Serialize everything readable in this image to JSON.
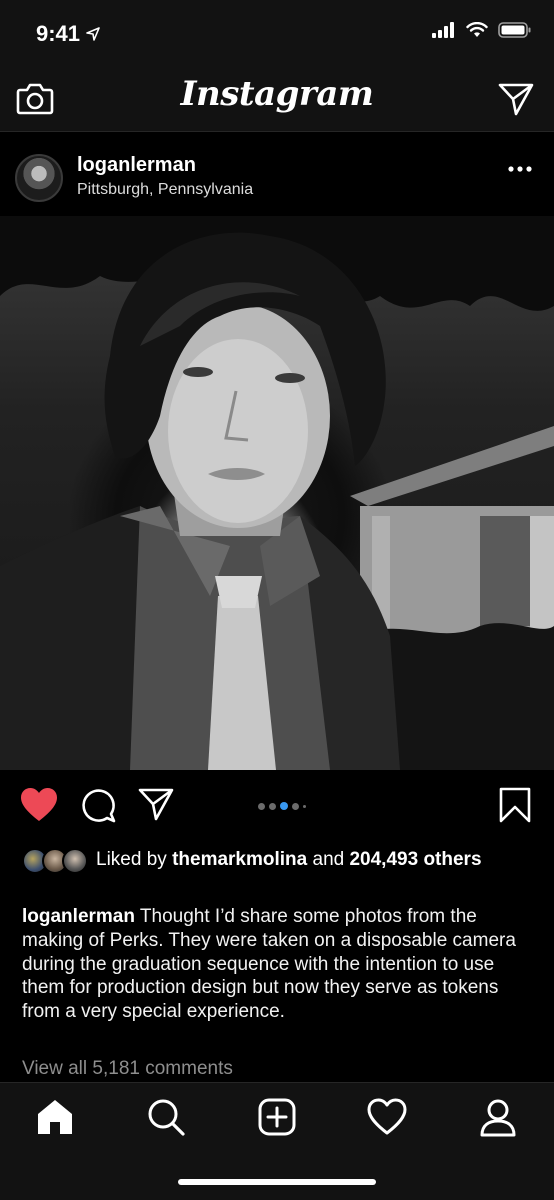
{
  "status_bar": {
    "time": "9:41",
    "location_icon": "location-arrow-icon",
    "signal_icon": "cellular-signal-icon",
    "wifi_icon": "wifi-icon",
    "battery_icon": "battery-icon"
  },
  "header": {
    "title": "Instagram",
    "camera_icon": "camera-icon",
    "direct_icon": "paper-plane-icon"
  },
  "post": {
    "username": "loganlerman",
    "location": "Pittsburgh, Pennsylvania",
    "more_icon": "ellipsis-icon",
    "photo": {
      "description_icon": "photo",
      "carousel_count": 5,
      "carousel_active_index": 2
    },
    "actions": {
      "like_icon": "heart-filled-icon",
      "like_color": "#ed4956",
      "comment_icon": "comment-bubble-icon",
      "share_icon": "paper-plane-icon",
      "save_icon": "bookmark-icon",
      "dot_active_color": "#3897f0"
    },
    "likes": {
      "prefix": "Liked by",
      "liker": "themarkmolina",
      "joiner": "and",
      "count": "204,493",
      "suffix": "others"
    },
    "caption": {
      "username": "loganlerman",
      "text": "Thought I’d share some photos from the making of Perks. They were taken on a disposable camera during the graduation sequence with the intention to use them for production design but now they serve as tokens from a very special experience."
    },
    "view_all_comments": "View all 5,181 comments"
  },
  "tabbar": {
    "items": [
      {
        "name": "home",
        "icon": "home-icon"
      },
      {
        "name": "search",
        "icon": "search-icon"
      },
      {
        "name": "new-post",
        "icon": "plus-square-icon"
      },
      {
        "name": "activity",
        "icon": "heart-outline-icon"
      },
      {
        "name": "profile",
        "icon": "person-icon"
      }
    ]
  }
}
